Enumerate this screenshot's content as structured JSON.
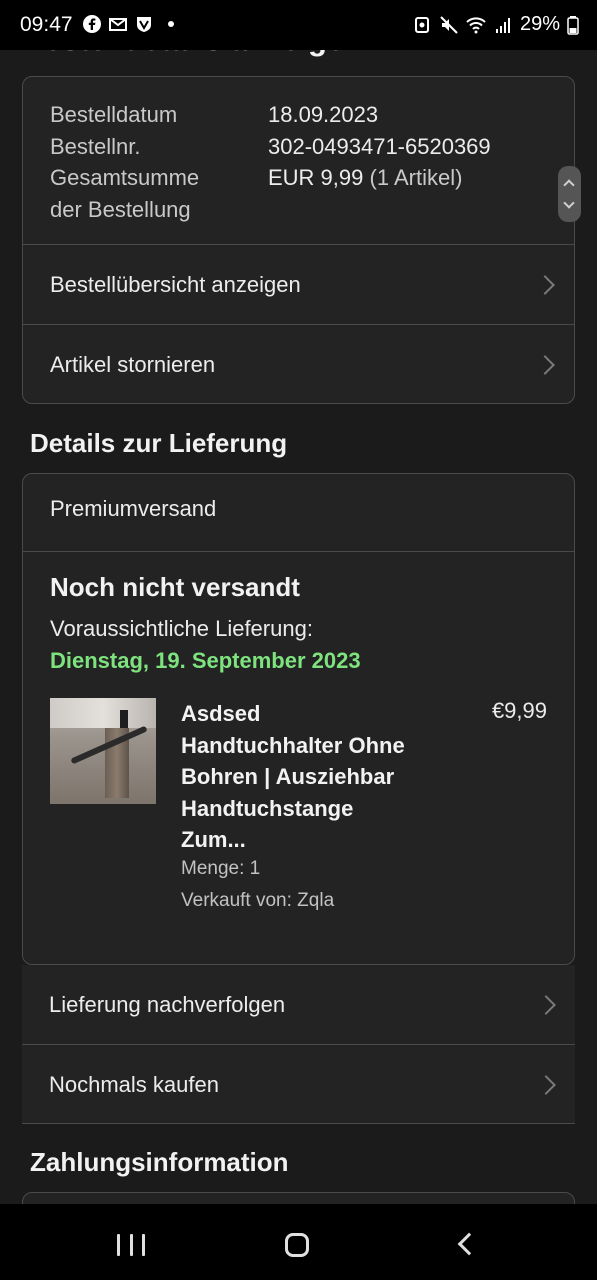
{
  "status_bar": {
    "time": "09:47",
    "battery_percent": "29%",
    "icons": [
      "facebook-icon",
      "gmail-icon",
      "shield-app-icon",
      "notification-dot-icon",
      "nfc-icon",
      "mute-icon",
      "wifi-icon",
      "signal-icon",
      "battery-icon"
    ]
  },
  "page": {
    "title": "Bestelldetails anzeigen"
  },
  "order_info": {
    "date_label": "Bestelldatum",
    "date_value": "18.09.2023",
    "number_label": "Bestellnr.",
    "number_value": "302-0493471-6520369",
    "total_label_line1": "Gesamtsumme",
    "total_label_line2": "der Bestellung",
    "total_value": "EUR 9,99",
    "total_items": "(1 Artikel)",
    "summary_link": "Bestellübersicht anzeigen",
    "cancel_link": "Artikel stornieren"
  },
  "delivery": {
    "section_title": "Details zur Lieferung",
    "shipping_type": "Premiumversand",
    "status": "Noch nicht versandt",
    "eta_label": "Voraussichtliche Lieferung:",
    "eta_date": "Dienstag, 19. September 2023",
    "product": {
      "title_lines": [
        "Asdsed",
        "Handtuchhalter Ohne",
        "Bohren | Ausziehbar",
        "Handtuchstange",
        "Zum..."
      ],
      "price": "€9,99",
      "quantity": "Menge: 1",
      "seller": "Verkauft von: Zqla"
    },
    "track_link": "Lieferung nachverfolgen",
    "buy_again_link": "Nochmals kaufen"
  },
  "payment": {
    "section_title": "Zahlungsinformation"
  },
  "colors": {
    "background": "#1b1b1b",
    "card": "#232323",
    "border": "#4a4a4a",
    "accent_green": "#7ee37e"
  }
}
